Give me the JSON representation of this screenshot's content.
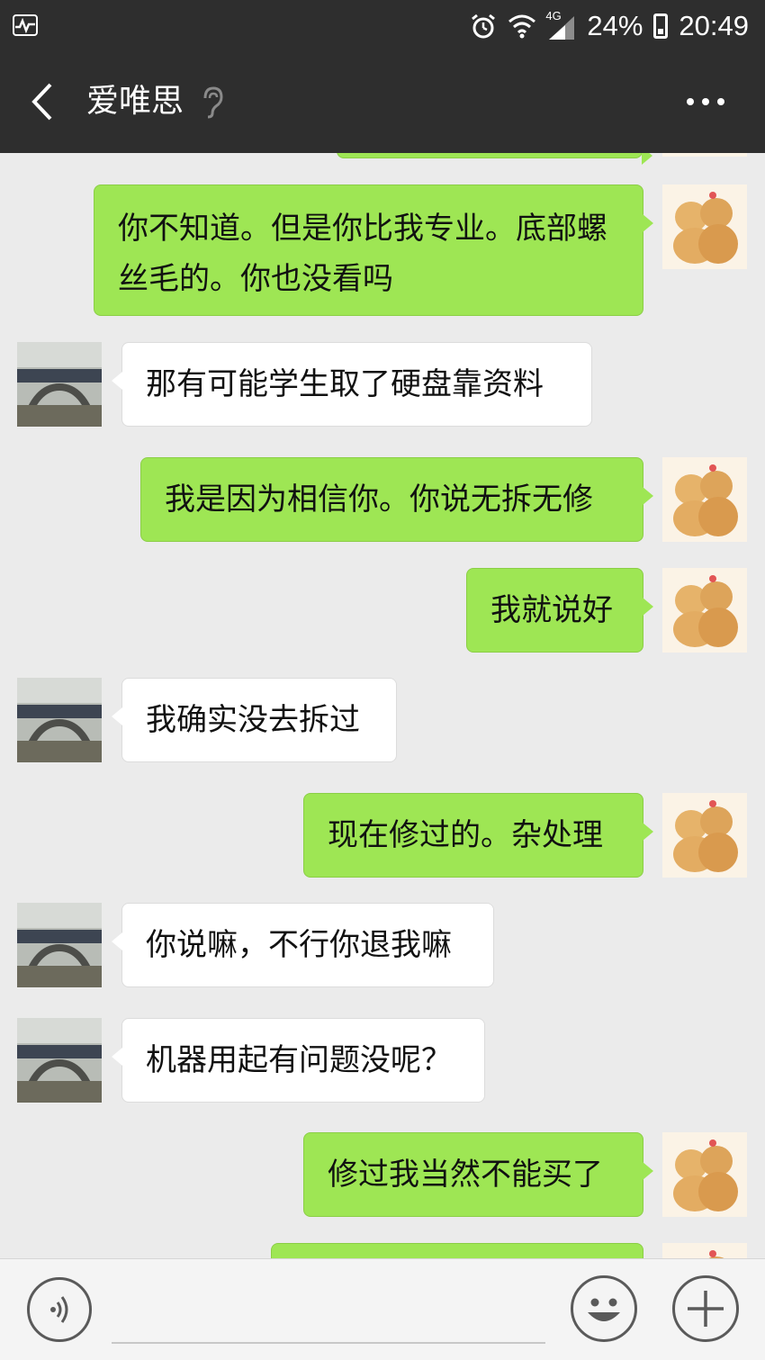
{
  "status_bar": {
    "network": "4G",
    "battery": "24%",
    "time": "20:49"
  },
  "navbar": {
    "title": "爱唯思"
  },
  "messages": [
    {
      "side": "out",
      "text": "你不知道。但是你比我专业。底部螺丝毛的。你也没看吗"
    },
    {
      "side": "in",
      "text": "那有可能学生取了硬盘靠资料"
    },
    {
      "side": "out",
      "text": "我是因为相信你。你说无拆无修"
    },
    {
      "side": "out",
      "text": "我就说好"
    },
    {
      "side": "in",
      "text": "我确实没去拆过"
    },
    {
      "side": "out",
      "text": "现在修过的。杂处理"
    },
    {
      "side": "in",
      "text": "你说嘛，不行你退我嘛"
    },
    {
      "side": "in",
      "text": "机器用起有问题没呢？"
    },
    {
      "side": "out",
      "text": "修过我当然不能买了"
    }
  ],
  "input_bar": {
    "value": ""
  },
  "icons": {
    "back": "back-arrow-icon",
    "mute": "ear-icon",
    "more": "more-dots-icon",
    "voice": "voice-icon",
    "emoji": "emoji-icon",
    "add": "plus-icon"
  },
  "colors": {
    "bar": "#2e2e2e",
    "bubble_out": "#9ee654",
    "bubble_in": "#ffffff",
    "background": "#ebebeb"
  }
}
